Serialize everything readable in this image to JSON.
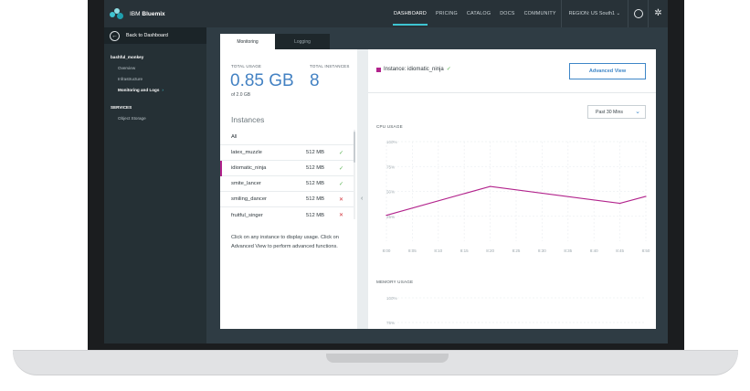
{
  "nav": {
    "brand_prefix": "IBM ",
    "brand_name": "Bluemix",
    "items": [
      "DASHBOARD",
      "PRICING",
      "CATALOG",
      "DOCS",
      "COMMUNITY"
    ],
    "active_item": "DASHBOARD",
    "region": "REGION: US South1 ⌄",
    "accent_color": "#3ec4d1"
  },
  "sidebar": {
    "back_label": "Back to Dashboard",
    "app_section": "bashful_monkey",
    "app_items": [
      "Overview",
      "Infrastructure",
      "Monitoring and Logs"
    ],
    "active_item": "Monitoring and Logs",
    "services_section": "SERVICES",
    "service_items": [
      "Object Storage"
    ]
  },
  "tabs": [
    "Monitoring",
    "Logging"
  ],
  "usage": {
    "total_usage_label": "TOTAL USAGE",
    "total_usage_value": "0.85 GB",
    "total_usage_sub": "of 2.0 GB",
    "total_instances_label": "TOTAL INSTANCES",
    "total_instances_value": "8"
  },
  "instances": {
    "title": "Instances",
    "all_label": "All",
    "rows": [
      {
        "name": "latex_muzzle",
        "size": "512 MB",
        "status": "ok"
      },
      {
        "name": "idiomatic_ninja",
        "size": "512 MB",
        "status": "ok"
      },
      {
        "name": "smite_lancer",
        "size": "512 MB",
        "status": "ok"
      },
      {
        "name": "smiling_dancer",
        "size": "512 MB",
        "status": "error"
      },
      {
        "name": "fruitful_singer",
        "size": "512 MB",
        "status": "error"
      }
    ],
    "selected": "idiomatic_ninja",
    "help_text": "Click on any instance to display usage. Click on Advanced View to perform advanced functions."
  },
  "detail": {
    "instance_heading": "Instance: idiomatic_ninja",
    "advanced_button": "Advanced View",
    "time_range": "Past 30 Mins",
    "series_color": "#b2238c"
  },
  "chart_data": [
    {
      "type": "line",
      "title": "CPU USAGE",
      "x": [
        "8:00",
        "8:05",
        "8:10",
        "8:15",
        "8:20",
        "8:25",
        "8:30",
        "8:35",
        "8:40",
        "8:45",
        "8:50"
      ],
      "y_ticks": [
        "100%",
        "75%",
        "50%",
        "25%"
      ],
      "ylim": [
        0,
        100
      ],
      "grid": true,
      "series": [
        {
          "values": [
            26,
            null,
            null,
            null,
            55,
            null,
            null,
            null,
            null,
            38,
            45
          ]
        }
      ]
    },
    {
      "type": "line",
      "title": "MEMORY USAGE",
      "y_ticks": [
        "100%",
        "75%"
      ],
      "ylim": [
        0,
        100
      ],
      "grid": true,
      "series": []
    }
  ]
}
